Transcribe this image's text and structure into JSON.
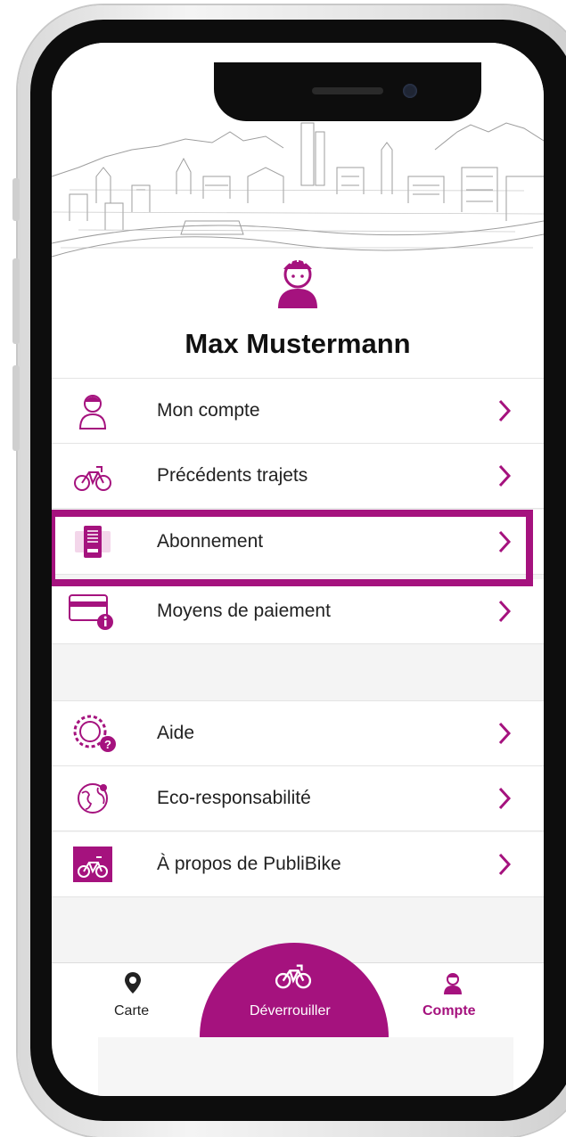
{
  "user": {
    "name": "Max Mustermann"
  },
  "menu_group_1": [
    {
      "label": "Mon compte",
      "icon": "user-icon"
    },
    {
      "label": "Précédents trajets",
      "icon": "bike-icon"
    },
    {
      "label": "Abonnement",
      "icon": "subscription-card-icon"
    },
    {
      "label": "Moyens de paiement",
      "icon": "payment-card-icon"
    }
  ],
  "menu_group_2": [
    {
      "label": "Aide",
      "icon": "gear-help-icon"
    },
    {
      "label": "Eco-responsabilité",
      "icon": "globe-icon"
    },
    {
      "label": "À propos de PubliBike",
      "icon": "publibike-logo-icon"
    }
  ],
  "tabbar": {
    "map_label": "Carte",
    "unlock_label": "Déverrouiller",
    "account_label": "Compte"
  },
  "colors": {
    "accent": "#a5127e",
    "text": "#222222",
    "separator": "#e4e4e4"
  }
}
